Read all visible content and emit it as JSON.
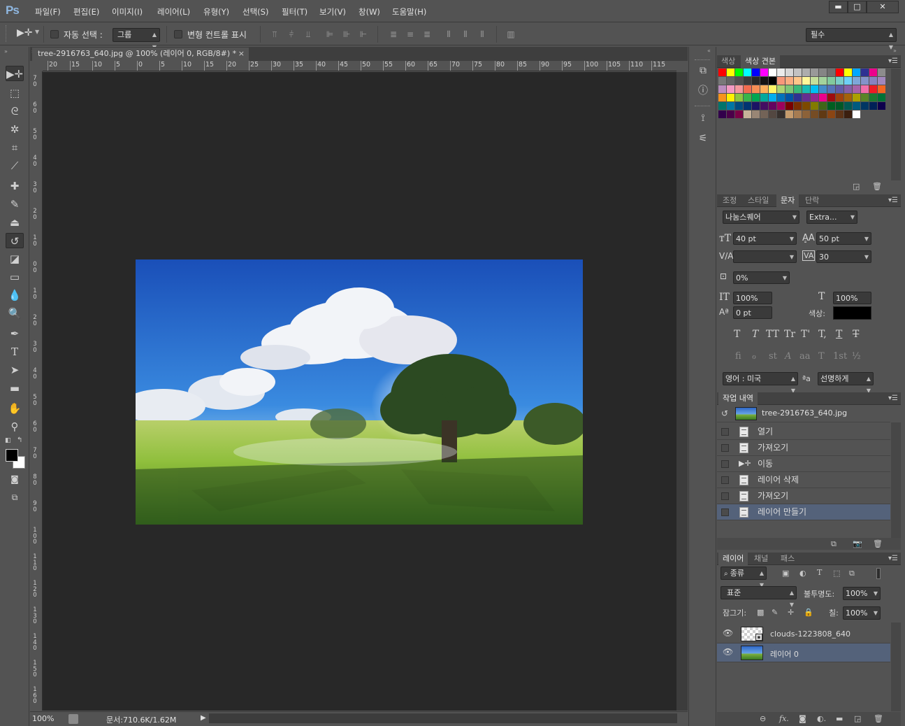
{
  "app": {
    "logo": "Ps"
  },
  "menu": [
    "파일(F)",
    "편집(E)",
    "이미지(I)",
    "레이어(L)",
    "유형(Y)",
    "선택(S)",
    "필터(T)",
    "보기(V)",
    "창(W)",
    "도움말(H)"
  ],
  "window_controls": {
    "minimize": "▬",
    "maximize": "□",
    "close": "✕"
  },
  "options": {
    "auto_select_label": "자동 선택 :",
    "auto_select_value": "그룹",
    "transform_label": "변형 컨트롤 표시",
    "workspace": "필수"
  },
  "document": {
    "tab_title": "tree-2916763_640.jpg @ 100% (레이어 0, RGB/8#) *",
    "close": "×",
    "h_ruler": [
      "20",
      "15",
      "10",
      "5",
      "0",
      "5",
      "10",
      "15",
      "20",
      "25",
      "30",
      "35",
      "40",
      "45",
      "50",
      "55",
      "60",
      "65",
      "70",
      "75",
      "80",
      "85",
      "90",
      "95",
      "100",
      "105",
      "110",
      "115"
    ],
    "v_ruler": [
      "7",
      "6",
      "5",
      "4",
      "3",
      "2",
      "1",
      "0",
      "1",
      "2",
      "3",
      "4",
      "5",
      "6",
      "7",
      "8",
      "9",
      "10",
      "11",
      "12",
      "13",
      "14",
      "15",
      "16"
    ],
    "zoom": "100%",
    "doc_size": "문서:710.6K/1.62M"
  },
  "swatches_panel": {
    "tabs": [
      "색상",
      "색상 견본"
    ],
    "active_tab": "색상 견본",
    "colors": [
      "#ff0000",
      "#ffff00",
      "#00ff00",
      "#00ffff",
      "#0000ff",
      "#ff00ff",
      "#ffffff",
      "#ebebeb",
      "#d6d6d6",
      "#c2c2c2",
      "#adadad",
      "#999999",
      "#858585",
      "#707070",
      "#ff0000",
      "#ffff00",
      "#00a8ff",
      "#2e3192",
      "#ec008c",
      "#8c8c8c",
      "#787878",
      "#646464",
      "#505050",
      "#3c3c3c",
      "#282828",
      "#141414",
      "#000000",
      "#f7977a",
      "#f9ad81",
      "#fdc68a",
      "#fff79a",
      "#c4df9b",
      "#a3d39c",
      "#82ca9d",
      "#7bcdc8",
      "#6ecff6",
      "#7ea7d8",
      "#8493ca",
      "#8882be",
      "#a187be",
      "#bc8dbf",
      "#f49ac2",
      "#f6989d",
      "#f26c4f",
      "#f68e55",
      "#fbaf5c",
      "#fff467",
      "#acd372",
      "#7cc576",
      "#3bb878",
      "#1abbb4",
      "#00bff3",
      "#438cca",
      "#5574b9",
      "#605ca8",
      "#855fa8",
      "#a763a8",
      "#f06eaa",
      "#ed1c24",
      "#f26522",
      "#f7941d",
      "#fff200",
      "#8dc73f",
      "#39b54a",
      "#00a651",
      "#00a99d",
      "#00aeef",
      "#0072bc",
      "#0054a6",
      "#2e3192",
      "#662d91",
      "#92278f",
      "#ec008c",
      "#9e0b0f",
      "#a0410d",
      "#a3620a",
      "#aba000",
      "#598527",
      "#1a7b30",
      "#007236",
      "#00746b",
      "#0076a3",
      "#004b80",
      "#003471",
      "#1b1464",
      "#440e62",
      "#630460",
      "#9e005d",
      "#790000",
      "#7b2e00",
      "#7d4900",
      "#827b00",
      "#406618",
      "#005e20",
      "#005826",
      "#005952",
      "#005b7f",
      "#003663",
      "#002157",
      "#0d004c",
      "#32004b",
      "#4b0049",
      "#7a0045",
      "#c7b299",
      "#998675",
      "#736357",
      "#534741",
      "#37302d",
      "#c69c6d",
      "#a67c52",
      "#8c6239",
      "#754c24",
      "#603913",
      "#8b4513",
      "#5c3317",
      "#3b1f0f",
      "#ffffff"
    ]
  },
  "character_panel": {
    "tabs": [
      "조정",
      "스타일",
      "문자",
      "단락"
    ],
    "active_tab": "문자",
    "font_family": "나눔스퀘어",
    "font_style": "Extra...",
    "font_size": "40 pt",
    "leading": "50 pt",
    "kerning": "",
    "tracking": "30",
    "tsume": "0%",
    "vscale": "100%",
    "hscale": "100%",
    "baseline": "0 pt",
    "color_label": "색상:",
    "color": "#000000",
    "type_buttons": [
      "T",
      "T",
      "TT",
      "Tr",
      "T'",
      "T,",
      "T",
      "T"
    ],
    "ot_buttons": [
      "fi",
      "ℴ",
      "st",
      "A",
      "aa",
      "T",
      "1st",
      "½"
    ],
    "language": "영어 : 미국",
    "aa_label": "ªa",
    "antialias": "선명하게"
  },
  "history_panel": {
    "tab": "작업 내역",
    "snapshot": "tree-2916763_640.jpg",
    "items": [
      "열기",
      "가져오기",
      "이동",
      "레이어 삭제",
      "가져오기",
      "레이어 만들기"
    ],
    "selected_index": 5
  },
  "layers_panel": {
    "tabs": [
      "레이어",
      "채널",
      "패스"
    ],
    "active_tab": "레이어",
    "filter": "종류",
    "blend_mode": "표준",
    "opacity_label": "불투명도:",
    "opacity": "100%",
    "lock_label": "잠그기:",
    "fill_label": "칠:",
    "fill": "100%",
    "layers": [
      {
        "name": "clouds-1223808_640",
        "visible": true,
        "selected": false
      },
      {
        "name": "레이어 0",
        "visible": true,
        "selected": true
      }
    ]
  }
}
